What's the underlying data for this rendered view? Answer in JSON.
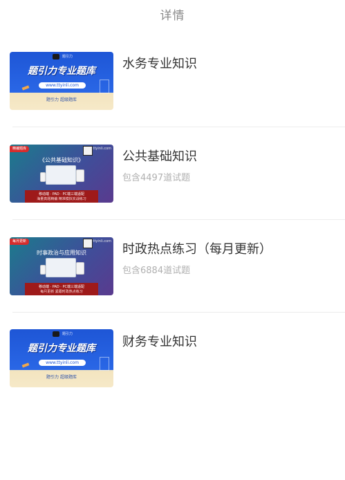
{
  "header": {
    "title": "详情"
  },
  "items": [
    {
      "name": "水务专业知识",
      "count": "",
      "thumb": {
        "style": "brand",
        "logo_text": "题引力",
        "headline": "题引力专业题库",
        "url": "www.ttyinli.com",
        "tagline": "题引力 超级题库"
      }
    },
    {
      "name": "公共基础知识",
      "count": "包含4497道试题",
      "thumb": {
        "style": "promo",
        "flag": "精编题库",
        "site": "ttyinli.com",
        "headline": "《公共基础知识》",
        "line1": "移动端 · PAD · PC端三端适配",
        "line2": "海量真题精编 精准模拟实战练习"
      }
    },
    {
      "name": "时政热点练习（每月更新）",
      "count": "包含6884道试题",
      "thumb": {
        "style": "promo",
        "flag": "每月更新",
        "site": "ttyinli.com",
        "headline": "时事政治与应用知识",
        "line1": "移动端 · PAD · PC端三端适配",
        "line2": "每月更新 紧跟时政热点练习"
      }
    },
    {
      "name": "财务专业知识",
      "count": "",
      "thumb": {
        "style": "brand",
        "logo_text": "题引力",
        "headline": "题引力专业题库",
        "url": "www.ttyinli.com",
        "tagline": "题引力 超级题库"
      }
    }
  ]
}
